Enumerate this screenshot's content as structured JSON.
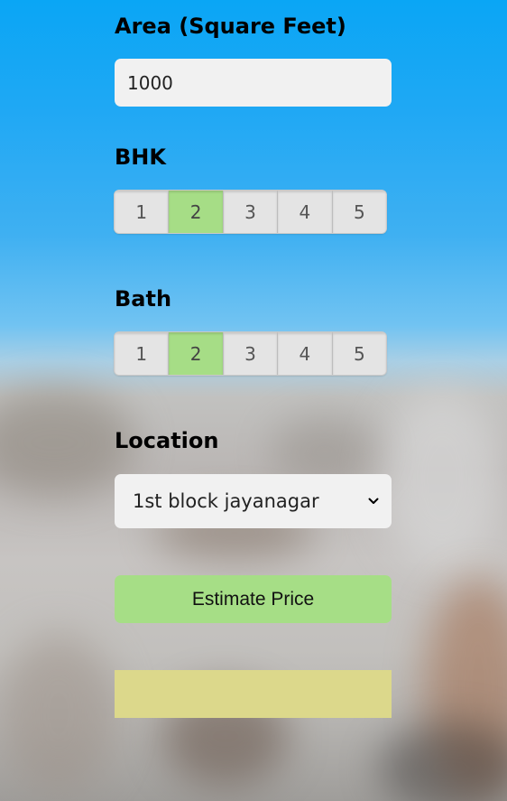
{
  "area": {
    "label": "Area (Square Feet)",
    "value": "1000"
  },
  "bhk": {
    "label": "BHK",
    "options": [
      "1",
      "2",
      "3",
      "4",
      "5"
    ],
    "selected": "2"
  },
  "bath": {
    "label": "Bath",
    "options": [
      "1",
      "2",
      "3",
      "4",
      "5"
    ],
    "selected": "2"
  },
  "location": {
    "label": "Location",
    "selected": "1st block jayanagar",
    "icon": "chevron-down-icon"
  },
  "estimate_button": {
    "label": "Estimate Price"
  },
  "result": {
    "text": ""
  },
  "colors": {
    "selected_segment": "#a6dd86",
    "button": "#a6de86",
    "result_box": "#dcd88b"
  }
}
